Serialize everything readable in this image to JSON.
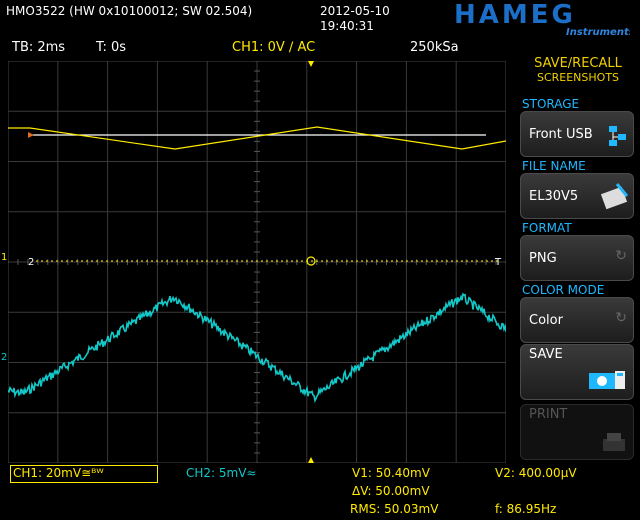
{
  "header": {
    "device": "HMO3522 (HW 0x10100012; SW 02.504)",
    "date": "2012-05-10",
    "time": "19:40:31",
    "brand": "HAMEG",
    "brand_sub": "Instruments"
  },
  "infobar": {
    "timebase": "TB: 2ms",
    "trigger_time": "T: 0s",
    "ch1": "CH1: 0V ∕ AC",
    "sample_rate": "250kSa"
  },
  "markers": {
    "ch1_left": "1",
    "ch2_left": "2",
    "ch2_mid": "2",
    "trig_right": "T"
  },
  "menu": {
    "title_line1": "SAVE/RECALL",
    "title_line2": "SCREENSHOTS",
    "items": [
      {
        "head": "STORAGE",
        "value": "Front USB",
        "icon": "usb-folder-icon"
      },
      {
        "head": "FILE NAME",
        "value": "EL30V5",
        "icon": "keyboard-edit-icon"
      },
      {
        "head": "FORMAT",
        "value": "PNG",
        "icon": "cycle-arrow-icon"
      },
      {
        "head": "COLOR MODE",
        "value": "Color",
        "icon": "cycle-arrow-icon"
      }
    ],
    "save": "SAVE",
    "print": "PRINT"
  },
  "bottom": {
    "ch1": "CH1: 20mV≅ᴮᵂ",
    "ch2": "CH2: 5mV≈",
    "v1": "V1: 50.40mV",
    "v2": "V2: 400.00µV",
    "dv": "ΔV: 50.00mV",
    "rms": "RMS: 50.03mV",
    "f": "f: 86.95Hz"
  },
  "colors": {
    "ch1": "#ffea00",
    "ch2": "#12c8c8",
    "accent": "#1fb8ff",
    "title": "#f0d000"
  }
}
